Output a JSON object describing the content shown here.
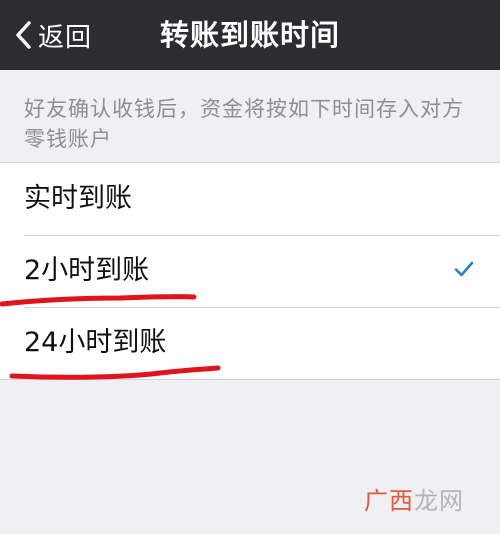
{
  "nav": {
    "back_label": "返回",
    "title": "转账到账时间"
  },
  "description": "好友确认收钱后，资金将按如下时间存入对方零钱账户",
  "options": [
    {
      "label": "实时到账",
      "selected": false
    },
    {
      "label": "2小时到账",
      "selected": true
    },
    {
      "label": "24小时到账",
      "selected": false
    }
  ],
  "watermark": {
    "text_a": "广西",
    "text_b": "龙网"
  },
  "colors": {
    "navbar": "#2c2c31",
    "check": "#2b7cd3",
    "annotation": "#e0141c"
  }
}
